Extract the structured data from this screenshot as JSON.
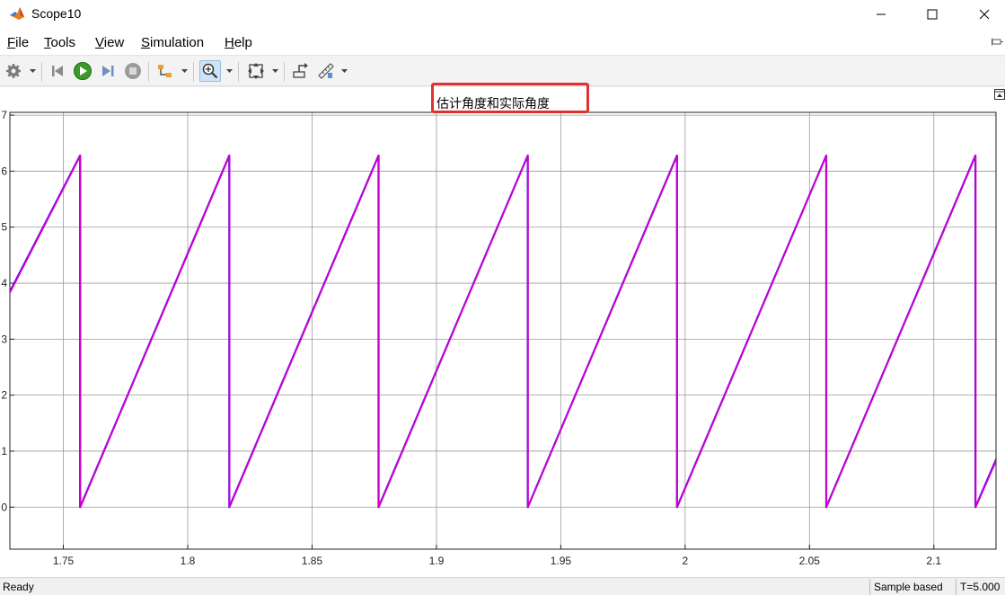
{
  "window": {
    "title": "Scope10",
    "controls": [
      "minimize-icon",
      "maximize-icon",
      "close-icon"
    ]
  },
  "menu": {
    "items": [
      {
        "label": "File",
        "mnemonic": "F",
        "rest": "ile"
      },
      {
        "label": "Tools",
        "mnemonic": "T",
        "rest": "ools"
      },
      {
        "label": "View",
        "mnemonic": "V",
        "rest": "iew"
      },
      {
        "label": "Simulation",
        "mnemonic": "S",
        "rest": "imulation"
      },
      {
        "label": "Help",
        "mnemonic": "H",
        "rest": "elp"
      }
    ]
  },
  "toolbar": {
    "icons": [
      "gear-icon",
      "step-back-icon",
      "run-icon",
      "step-forward-icon",
      "stop-icon",
      "signal-selector-icon",
      "zoom-icon",
      "autoscale-icon",
      "highlight-block-icon",
      "measure-icon"
    ],
    "active": "zoom-icon"
  },
  "plot": {
    "title": "估计角度和实际角度",
    "highlight_color": "#e03131"
  },
  "chart_data": {
    "type": "line",
    "title": "估计角度和实际角度",
    "xlim": [
      1.7285,
      2.125
    ],
    "ylim": [
      -0.75,
      7.05
    ],
    "x_ticks": [
      1.75,
      1.8,
      1.85,
      1.9,
      1.95,
      2,
      2.05,
      2.1
    ],
    "x_tick_labels": [
      "1.75",
      "1.8",
      "1.85",
      "1.9",
      "1.95",
      "2",
      "2.05",
      "2.1"
    ],
    "y_ticks": [
      0,
      1,
      2,
      3,
      4,
      5,
      6,
      7
    ],
    "y_tick_labels": [
      "0",
      "1",
      "2",
      "3",
      "4",
      "5",
      "6",
      "7"
    ],
    "grid": true,
    "series": [
      {
        "color": "#0000ff",
        "x": [
          1.7285,
          1.7567,
          1.7567,
          1.8167,
          1.8167,
          1.8767,
          1.8767,
          1.9367,
          1.9367,
          1.9967,
          1.9967,
          2.0567,
          2.0567,
          2.1167,
          2.1167,
          2.125
        ],
        "y": [
          3.85,
          6.28,
          0,
          6.28,
          0,
          6.28,
          0,
          6.28,
          0,
          6.28,
          0,
          6.28,
          0,
          6.28,
          0,
          0.85
        ]
      },
      {
        "color": "#cc00cc",
        "x": [
          1.7285,
          1.7568,
          1.7568,
          1.8168,
          1.8168,
          1.8768,
          1.8768,
          1.9368,
          1.9368,
          1.9968,
          1.9968,
          2.0568,
          2.0568,
          2.1168,
          2.1168,
          2.125
        ],
        "y": [
          3.83,
          6.28,
          0,
          6.28,
          0,
          6.28,
          0,
          6.28,
          0,
          6.28,
          0,
          6.28,
          0,
          6.28,
          0,
          0.83
        ]
      }
    ]
  },
  "status": {
    "left": "Ready",
    "mode": "Sample based",
    "time": "T=5.000"
  }
}
